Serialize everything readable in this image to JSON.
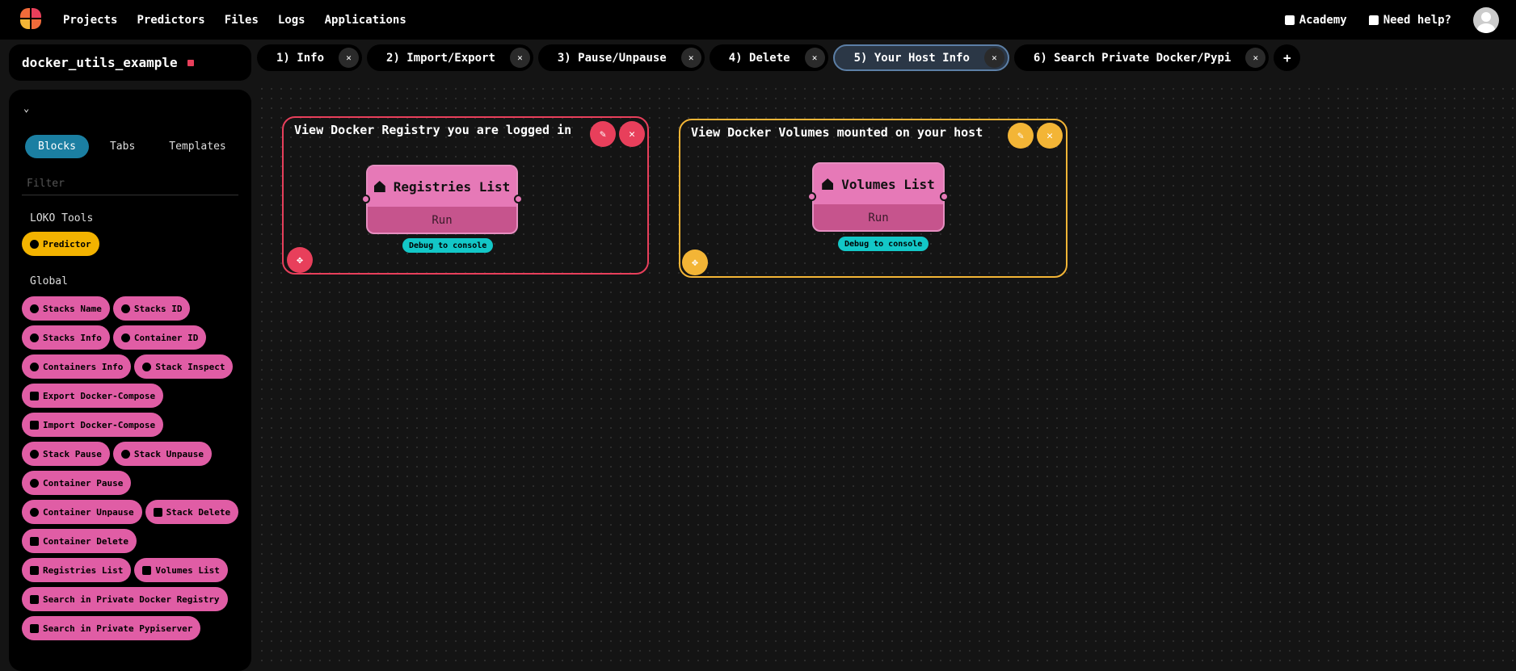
{
  "nav": {
    "items": [
      "Projects",
      "Predictors",
      "Files",
      "Logs",
      "Applications"
    ],
    "academy": "Academy",
    "help": "Need help?"
  },
  "project": {
    "name": "docker_utils_example"
  },
  "tabs": [
    {
      "label": "1) Info"
    },
    {
      "label": "2) Import/Export"
    },
    {
      "label": "3) Pause/Unpause"
    },
    {
      "label": "4) Delete"
    },
    {
      "label": "5) Your Host Info",
      "active": true
    },
    {
      "label": "6) Search Private Docker/Pypi"
    }
  ],
  "add_tab": "+",
  "sidebar": {
    "modes": [
      "Blocks",
      "Tabs",
      "Templates"
    ],
    "active_mode": "Blocks",
    "filter_placeholder": "Filter",
    "loko_tools_label": "LOKO Tools",
    "predictor": "Predictor",
    "global_label": "Global",
    "blocks": [
      "Stacks Name",
      "Stacks ID",
      "Stacks Info",
      "Container ID",
      "Containers Info",
      "Stack Inspect",
      "Export Docker-Compose",
      "Import Docker-Compose",
      "Stack Pause",
      "Stack Unpause",
      "Container Pause",
      "Container Unpause",
      "Stack Delete",
      "Container Delete",
      "Registries List",
      "Volumes List",
      "Search in Private Docker Registry",
      "Search in Private Pypiserver"
    ]
  },
  "groups": [
    {
      "title": "View Docker Registry you are logged in",
      "color": "#e83f5b",
      "node": {
        "label": "Registries List",
        "run": "Run",
        "debug": "Debug to console"
      }
    },
    {
      "title": "View Docker Volumes mounted on your host",
      "color": "#f3b536",
      "node": {
        "label": "Volumes List",
        "run": "Run",
        "debug": "Debug to console"
      }
    }
  ],
  "colors": {
    "accent_blue": "#1b7fa2",
    "node_pink": "#e679b7",
    "group_red": "#e83f5b",
    "group_yellow": "#f3b536",
    "debug_cyan": "#13c7c7"
  }
}
